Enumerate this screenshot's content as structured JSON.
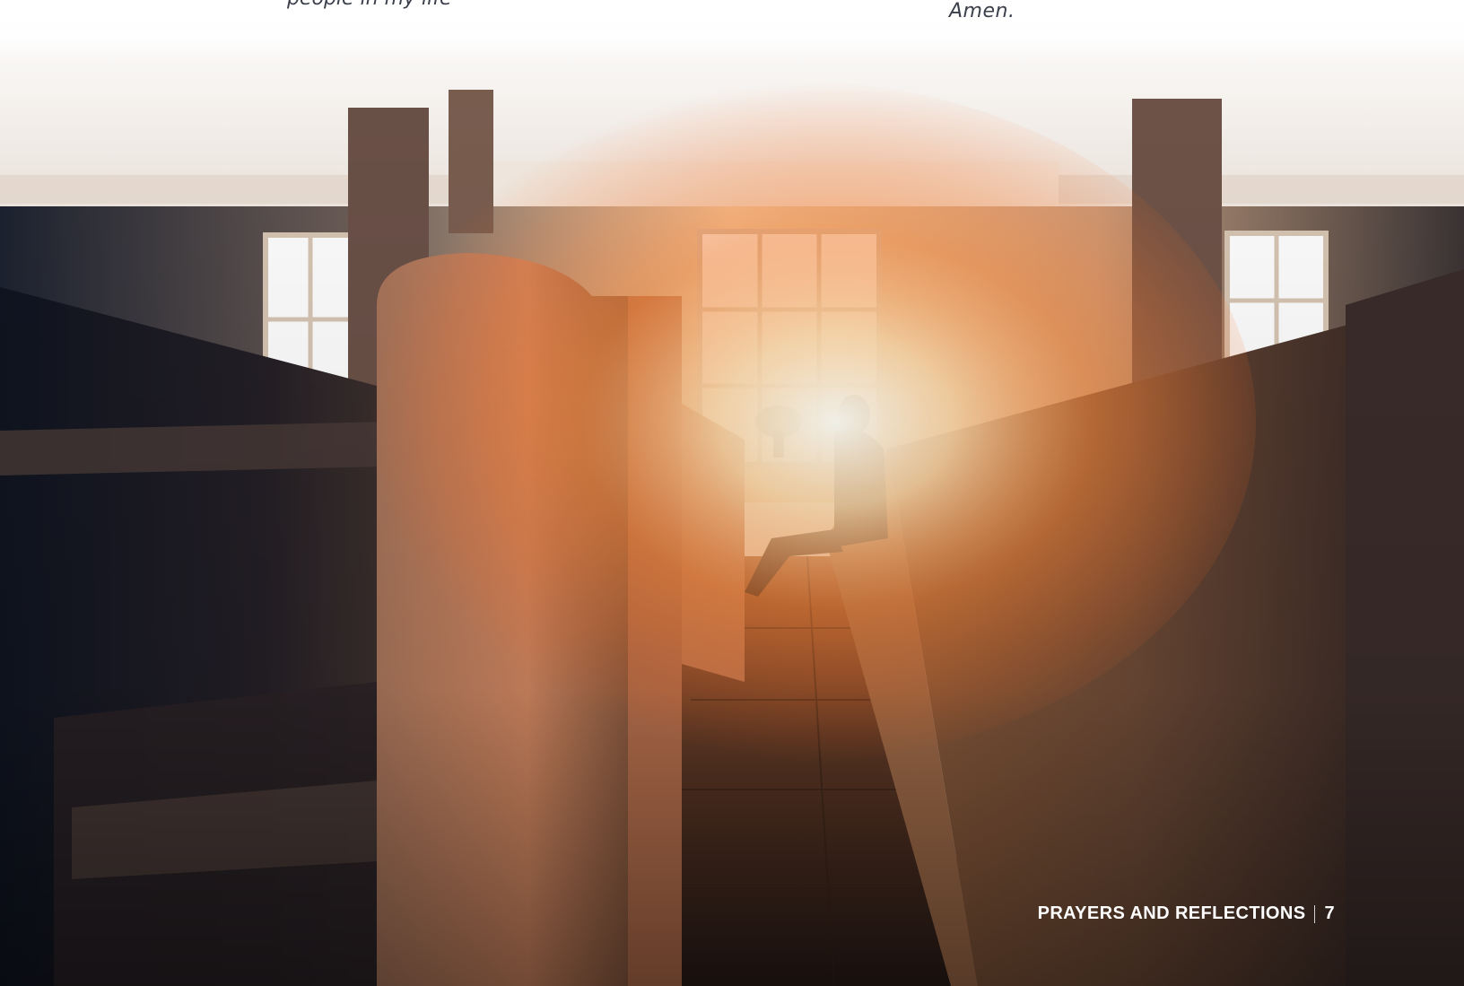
{
  "text": {
    "cutoff_line": "people in my life",
    "amen": "Amen."
  },
  "footer": {
    "section": "PRAYERS AND REFLECTIONS",
    "page_number": "7"
  },
  "colors": {
    "body_text": "#3a3f4a",
    "footer_text": "#ffffff",
    "glow": "#ff7a2e"
  },
  "image": {
    "icon": "church-pews-photo"
  }
}
